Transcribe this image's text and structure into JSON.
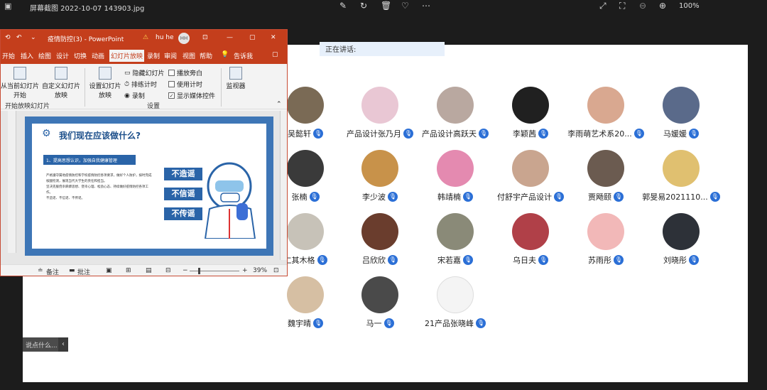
{
  "viewer": {
    "filename": "屏幕截图 2022-10-07 143903.jpg",
    "zoom": "100%"
  },
  "meeting": {
    "speaking_label": "正在讲话:",
    "participants": [
      {
        "name": "吴懿轩",
        "color": "#7a6a55"
      },
      {
        "name": "产品设计张乃月",
        "color": "#e9c7d4"
      },
      {
        "name": "产品设计高跃天",
        "color": "#b9a8a0"
      },
      {
        "name": "李颖茜",
        "color": "#202020"
      },
      {
        "name": "李雨萌艺术系20...",
        "color": "#d9a890"
      },
      {
        "name": "马媛媛",
        "color": "#5a6a8a"
      },
      {
        "name": "张楠",
        "color": "#3a3a3a"
      },
      {
        "name": "李少波",
        "color": "#c8924a"
      },
      {
        "name": "韩靖楠",
        "color": "#e48ab0"
      },
      {
        "name": "付舒宇产品设计",
        "color": "#c9a58f"
      },
      {
        "name": "贾飏颐",
        "color": "#6b5b50"
      },
      {
        "name": "郭旻易2021110...",
        "color": "#e0c070"
      },
      {
        "name": "仁其木格",
        "color": "#c7c2b8"
      },
      {
        "name": "吕欣欣",
        "color": "#6a3d2d"
      },
      {
        "name": "宋若嘉",
        "color": "#8a8a78"
      },
      {
        "name": "乌日夫",
        "color": "#b04048"
      },
      {
        "name": "苏雨彤",
        "color": "#f2b8b8"
      },
      {
        "name": "刘晓彤",
        "color": "#2d3138"
      },
      {
        "name": "魏宇晴",
        "color": "#d6bfa3"
      },
      {
        "name": "马一",
        "color": "#4a4a4a"
      },
      {
        "name": "21产品张晓峰",
        "color": "#f4f4f4"
      }
    ],
    "side_tag": "说点什么..."
  },
  "ppt": {
    "title": "疫情防控(3)  -  PowerPoint",
    "user": "hu he",
    "user_initials": "HH",
    "menu": [
      "开始",
      "插入",
      "绘图",
      "设计",
      "切换",
      "动画",
      "幻灯片放映",
      "录制",
      "审阅",
      "视图",
      "帮助",
      "告诉我"
    ],
    "ribbon": {
      "from_current": "从当前幻灯片开始",
      "custom_show": "自定义幻灯片放映",
      "group_start": "开始放映幻灯片",
      "setup_show": "设置幻灯片放映",
      "hide_slide": "隐藏幻灯片",
      "rehearse": "排练计时",
      "record": "录制",
      "play_narration": "播放旁白",
      "use_timings": "使用计时",
      "show_media": "显示媒体控件",
      "group_setup": "设置",
      "monitor": "监视器"
    },
    "slide": {
      "heading": "我们现在应该做什么?",
      "bar": "1、提高思想认识，加强自我健康管理",
      "bullets": [
        "严格遵守属地疫情防控和学校疫情防控各项要求，做好个人防护，按时完成核酸检测，展现当代大学生的责任和担当。",
        "坚决克服侥幸麻痹思想、侥幸心理、松劲心态、持续做好疫情防控各项工作。",
        "不造谣、不信谣、不传谣。"
      ],
      "tags": [
        "不造谣",
        "不信谣",
        "不传谣"
      ]
    },
    "status": {
      "notes": "备注",
      "comments": "批注",
      "zoom": "39%"
    }
  }
}
